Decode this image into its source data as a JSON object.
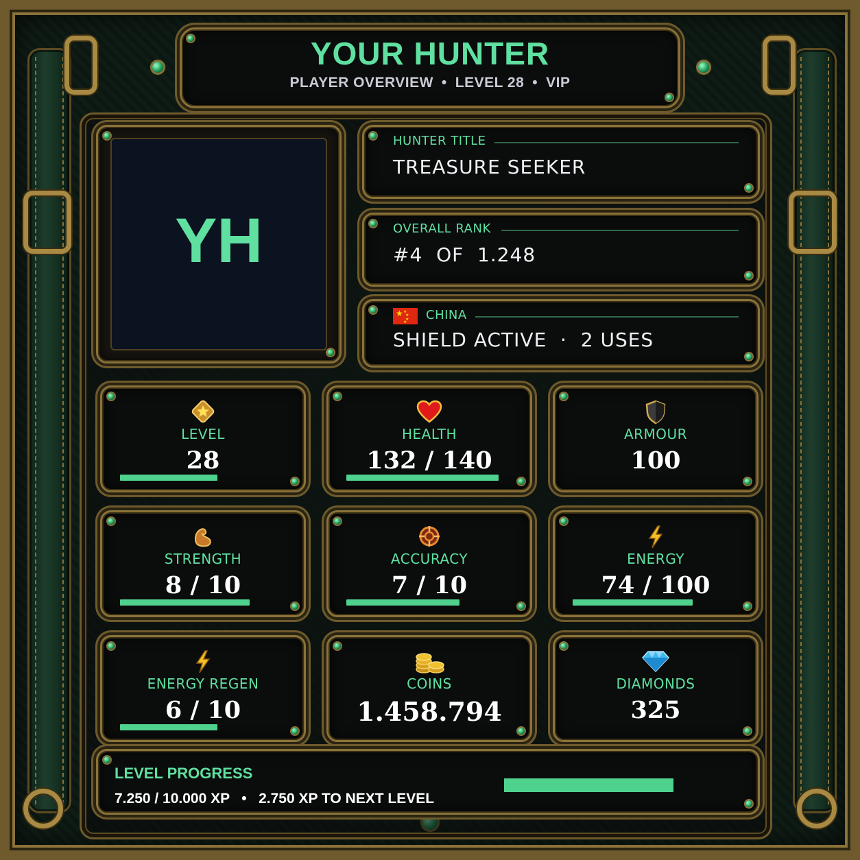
{
  "header": {
    "title": "YOUR HUNTER",
    "subtitle_parts": [
      "PLAYER OVERVIEW",
      "LEVEL 28",
      "VIP"
    ],
    "separator": "•"
  },
  "avatar": {
    "initials": "YH"
  },
  "info": {
    "title_label": "HUNTER TITLE",
    "title_value": "TREASURE SEEKER",
    "rank_label": "OVERALL RANK",
    "rank_value": "#4  OF  1.248",
    "country_label": "CHINA",
    "country_flag": "china-flag-icon",
    "shield_value": "SHIELD ACTIVE  ·  2 USES"
  },
  "stats": [
    {
      "icon": "star-icon",
      "label": "LEVEL",
      "value": "28",
      "progress": 0.6
    },
    {
      "icon": "heart-icon",
      "label": "HEALTH",
      "value": "132 / 140",
      "progress": 0.94
    },
    {
      "icon": "shield-icon",
      "label": "ARMOUR",
      "value": "100",
      "progress": null
    },
    {
      "icon": "flexed-arm-icon",
      "label": "STRENGTH",
      "value": "8 / 10",
      "progress": 0.8
    },
    {
      "icon": "crosshair-icon",
      "label": "ACCURACY",
      "value": "7 / 10",
      "progress": 0.7
    },
    {
      "icon": "lightning-icon",
      "label": "ENERGY",
      "value": "74 / 100",
      "progress": 0.74
    },
    {
      "icon": "lightning-icon",
      "label": "ENERGY REGEN",
      "value": "6 / 10",
      "progress": 0.6
    },
    {
      "icon": "coins-icon",
      "label": "COINS",
      "value": "1.458.794",
      "progress": null
    },
    {
      "icon": "diamond-icon",
      "label": "DIAMONDS",
      "value": "325",
      "progress": null
    }
  ],
  "level_progress": {
    "label": "LEVEL PROGRESS",
    "detail": "7.250 / 10.000 XP   •   2.750 XP TO NEXT LEVEL",
    "progress": 0.725
  },
  "colors": {
    "accent_green": "#5fe0a0",
    "bar_green": "#4fd28e",
    "gold_trim": "#8a7238",
    "panel_bg": "#0b0c0c"
  }
}
